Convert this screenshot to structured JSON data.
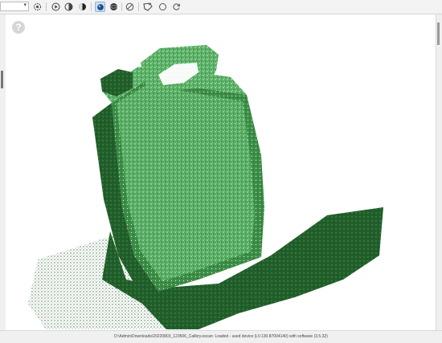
{
  "toolbar": {
    "view_select": {
      "value": ""
    },
    "buttons": [
      {
        "icon": "settings-icon"
      },
      {
        "icon": "play-icon"
      },
      {
        "icon": "contrast-icon"
      },
      {
        "icon": "half-fill-icon"
      },
      {
        "icon": "render-mode-points-icon",
        "active": true
      },
      {
        "icon": "sphere-icon"
      },
      {
        "icon": "disable-icon"
      },
      {
        "icon": "crop-icon"
      },
      {
        "icon": "circle-icon"
      },
      {
        "icon": "refresh-icon"
      }
    ]
  },
  "viewport": {
    "help_label": "?",
    "scan_color_light": "#5fb86a",
    "scan_color_dark": "#1f5e27"
  },
  "status": {
    "text": "D:\\Admin\\Downloads\\20220803_123506_Calibry.escan: Loaded - used device (LV.130.87004140) with software (3.5.32)"
  }
}
